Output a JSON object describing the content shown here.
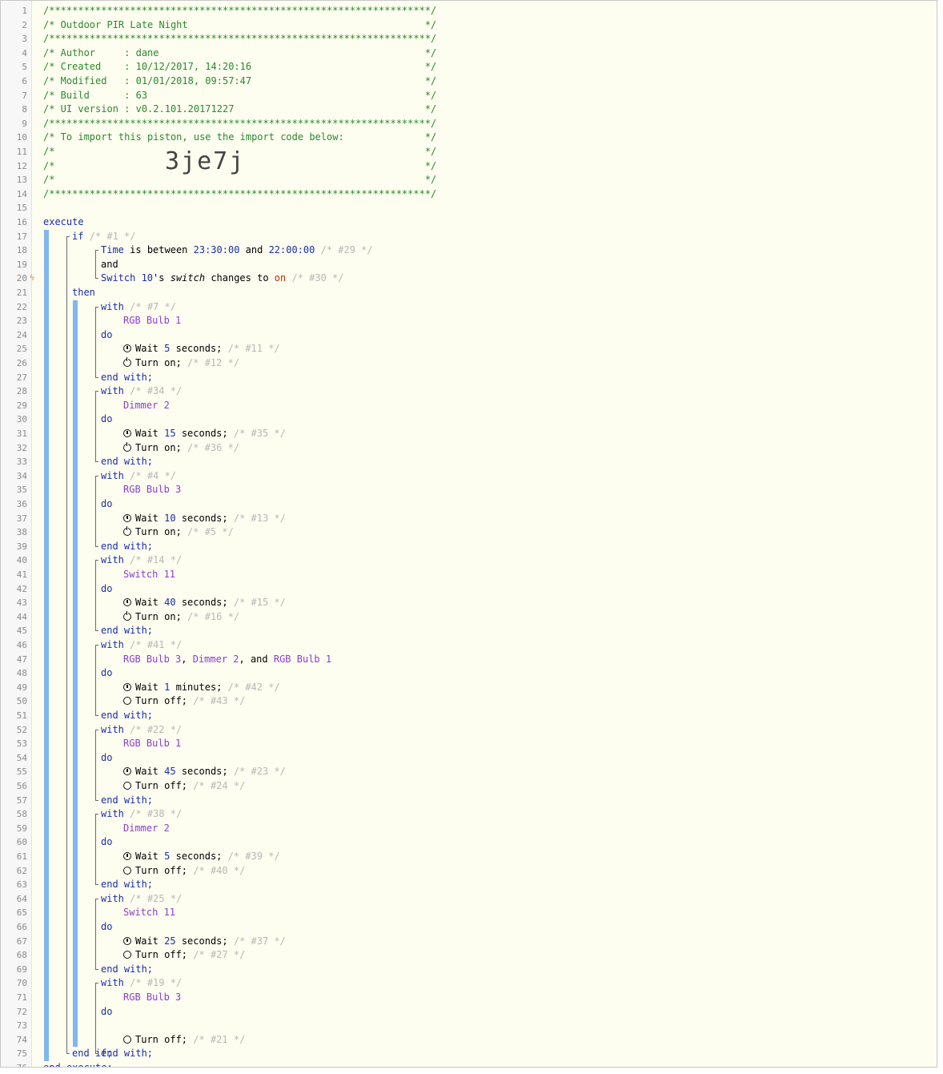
{
  "editor": {
    "line_numbers": [
      "1",
      "2",
      "3",
      "4",
      "5",
      "6",
      "7",
      "8",
      "9",
      "10",
      "11",
      "12",
      "13",
      "14",
      "15",
      "16",
      "17",
      "18",
      "19",
      "20",
      "21",
      "22",
      "23",
      "24",
      "25",
      "26",
      "27",
      "28",
      "29",
      "30",
      "31",
      "32",
      "33",
      "34",
      "35",
      "36",
      "37",
      "38",
      "39",
      "40",
      "41",
      "42",
      "43",
      "44",
      "45",
      "46",
      "47",
      "48",
      "49",
      "50",
      "51",
      "52",
      "53",
      "54",
      "55",
      "56",
      "57",
      "58",
      "59",
      "60",
      "61",
      "62",
      "63",
      "64",
      "65",
      "66",
      "67",
      "68",
      "69",
      "70",
      "71",
      "72",
      "73",
      "74",
      "75",
      "76"
    ],
    "header_lines": [
      "/******************************************************************/",
      "/* Outdoor PIR Late Night                                         */",
      "/******************************************************************/",
      "/* Author     : dane                                              */",
      "/* Created    : 10/12/2017, 14:20:16                              */",
      "/* Modified   : 01/01/2018, 09:57:47                              */",
      "/* Build      : 63                                                */",
      "/* UI version : v0.2.101.20171227                                 */",
      "/******************************************************************/",
      "/* To import this piston, use the import code below:              */",
      "/*                                                                */",
      "/*                                                                */",
      "/*                                                                */",
      "/******************************************************************/"
    ],
    "import_code": "3je7j",
    "bolt_icon": "lightning-bolt-icon",
    "execute_keyword": "execute",
    "if_keyword": "if",
    "if_comment": "/* #1 */",
    "condition1": {
      "device": "Time",
      "is_between": "is between",
      "from": "23:30:00",
      "and": "and",
      "to": "22:00:00",
      "comment": "/* #29 */"
    },
    "and_operator": "and",
    "condition2": {
      "device": "Switch 10",
      "possessive": "'s",
      "attribute": "switch",
      "changes_to": "changes to",
      "value": "on",
      "comment": "/* #30 */"
    },
    "then_keyword": "then",
    "with_keyword": "with",
    "do_keyword": "do",
    "end_with": "end with;",
    "end_if": "end if;",
    "end_execute": "end execute;",
    "wait_label": "Wait",
    "turn_on_label": "Turn on;",
    "turn_off_label": "Turn off;",
    "groups": [
      {
        "comment": "/* #7 */",
        "devices": [
          "RGB Bulb 1"
        ],
        "wait": {
          "value": "5",
          "unit": "seconds;",
          "comment": "/* #11 */"
        },
        "action": {
          "type": "on",
          "comment": "/* #12 */"
        }
      },
      {
        "comment": "/* #34 */",
        "devices": [
          "Dimmer 2"
        ],
        "wait": {
          "value": "15",
          "unit": "seconds;",
          "comment": "/* #35 */"
        },
        "action": {
          "type": "on",
          "comment": "/* #36 */"
        }
      },
      {
        "comment": "/* #4 */",
        "devices": [
          "RGB Bulb 3"
        ],
        "wait": {
          "value": "10",
          "unit": "seconds;",
          "comment": "/* #13 */"
        },
        "action": {
          "type": "on",
          "comment": "/* #5 */"
        }
      },
      {
        "comment": "/* #14 */",
        "devices": [
          "Switch 11"
        ],
        "wait": {
          "value": "40",
          "unit": "seconds;",
          "comment": "/* #15 */"
        },
        "action": {
          "type": "on",
          "comment": "/* #16 */"
        }
      },
      {
        "comment": "/* #41 */",
        "devices": [
          "RGB Bulb 3",
          "Dimmer 2",
          "RGB Bulb 1"
        ],
        "wait": {
          "value": "1",
          "unit": "minutes;",
          "comment": "/* #42 */"
        },
        "action": {
          "type": "off",
          "comment": "/* #43 */"
        }
      },
      {
        "comment": "/* #22 */",
        "devices": [
          "RGB Bulb 1"
        ],
        "wait": {
          "value": "45",
          "unit": "seconds;",
          "comment": "/* #23 */"
        },
        "action": {
          "type": "off",
          "comment": "/* #24 */"
        }
      },
      {
        "comment": "/* #38 */",
        "devices": [
          "Dimmer 2"
        ],
        "wait": {
          "value": "5",
          "unit": "seconds;",
          "comment": "/* #39 */"
        },
        "action": {
          "type": "off",
          "comment": "/* #40 */"
        }
      },
      {
        "comment": "/* #25 */",
        "devices": [
          "Switch 11"
        ],
        "wait": {
          "value": "25",
          "unit": "seconds;",
          "comment": "/* #37 */"
        },
        "action": {
          "type": "off",
          "comment": "/* #27 */"
        }
      },
      {
        "comment": "/* #19 */",
        "devices": [
          "RGB Bulb 3"
        ],
        "wait": null,
        "action": {
          "type": "off",
          "comment": "/* #21 */"
        }
      }
    ],
    "list_separator": ", ",
    "list_last": ", and ",
    "icons": {
      "wait": "clock-icon",
      "on": "power-on-icon",
      "off": "power-off-icon"
    },
    "colors": {
      "comment": "#2a8a2a",
      "keyword": "#1b2ea8",
      "device": "#8a3fd1",
      "muted_comment": "#b8b8b8",
      "bar": "#80b8ee",
      "background": "#fdfdf0"
    }
  }
}
